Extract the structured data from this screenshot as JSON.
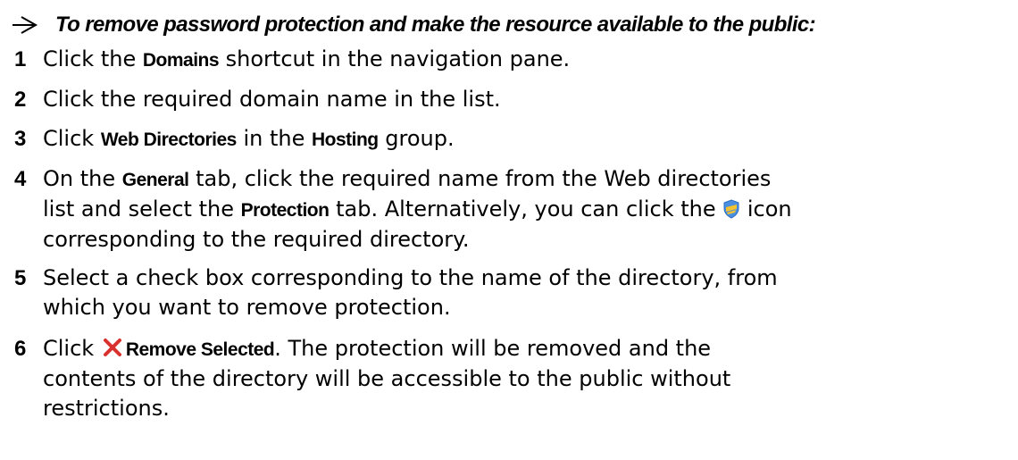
{
  "heading": "To remove password protection and make the resource available to the public:",
  "steps": {
    "s1": {
      "num": "1",
      "a": "Click the ",
      "b": "Domains",
      "c": " shortcut in the navigation pane."
    },
    "s2": {
      "num": "2",
      "a": "Click the required domain name in the list."
    },
    "s3": {
      "num": "3",
      "a": "Click ",
      "b": "Web Directories",
      "c": " in the ",
      "d": "Hosting",
      "e": " group."
    },
    "s4": {
      "num": "4",
      "a": "On the ",
      "b": "General",
      "c": " tab, click the required name from the Web directories",
      "d": "list and select the ",
      "e": "Protection",
      "f": " tab. Alternatively, you can click the ",
      "g": " icon",
      "h": "corresponding to the required directory."
    },
    "s5": {
      "num": "5",
      "a": "Select a check box corresponding to the name of the directory, from",
      "b": "which you want to remove protection."
    },
    "s6": {
      "num": "6",
      "a": "Click ",
      "b": "Remove Selected",
      "c": ". The protection will be removed and the",
      "d": "contents of the directory will be accessible to the public without",
      "e": "restrictions."
    }
  },
  "icons": {
    "heading_arrow": "arrowhead-bullet-icon",
    "protection": "shield-icon",
    "remove": "red-x-icon"
  },
  "colors": {
    "text": "#000000",
    "remove_x": "#d9322e",
    "shield_blue": "#4a8fe0",
    "shield_yellow": "#f2c230"
  }
}
